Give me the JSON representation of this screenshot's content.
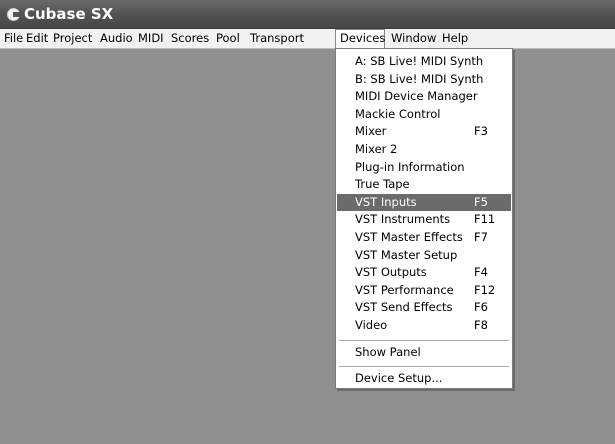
{
  "window": {
    "title": "Cubase SX"
  },
  "menubar": {
    "items": [
      {
        "label": "File"
      },
      {
        "label": "Edit"
      },
      {
        "label": "Project"
      },
      {
        "label": "Audio"
      },
      {
        "label": "MIDI"
      },
      {
        "label": "Scores"
      },
      {
        "label": "Pool"
      },
      {
        "label": "Transport"
      },
      {
        "label": "Devices",
        "active": true
      },
      {
        "label": "Window"
      },
      {
        "label": "Help"
      }
    ]
  },
  "devices_menu": {
    "items": [
      {
        "label": "A: SB Live! MIDI Synth",
        "shortcut": ""
      },
      {
        "label": "B: SB Live! MIDI Synth",
        "shortcut": ""
      },
      {
        "label": "MIDI Device Manager",
        "shortcut": ""
      },
      {
        "label": "Mackie Control",
        "shortcut": ""
      },
      {
        "label": "Mixer",
        "shortcut": "F3"
      },
      {
        "label": "Mixer 2",
        "shortcut": ""
      },
      {
        "label": "Plug-in Information",
        "shortcut": ""
      },
      {
        "label": "True Tape",
        "shortcut": ""
      },
      {
        "label": "VST Inputs",
        "shortcut": "F5",
        "highlighted": true
      },
      {
        "label": "VST Instruments",
        "shortcut": "F11"
      },
      {
        "label": "VST Master Effects",
        "shortcut": "F7"
      },
      {
        "label": "VST Master Setup",
        "shortcut": ""
      },
      {
        "label": "VST Outputs",
        "shortcut": "F4"
      },
      {
        "label": "VST Performance",
        "shortcut": "F12"
      },
      {
        "label": "VST Send Effects",
        "shortcut": "F6"
      },
      {
        "label": "Video",
        "shortcut": "F8"
      },
      {
        "label": "Show Panel",
        "shortcut": ""
      },
      {
        "label": "Device Setup...",
        "shortcut": ""
      }
    ]
  },
  "colors": {
    "workspace": "#8f8f8f",
    "titlebar": "#515151",
    "menu_highlight": "#6b6b6b"
  }
}
